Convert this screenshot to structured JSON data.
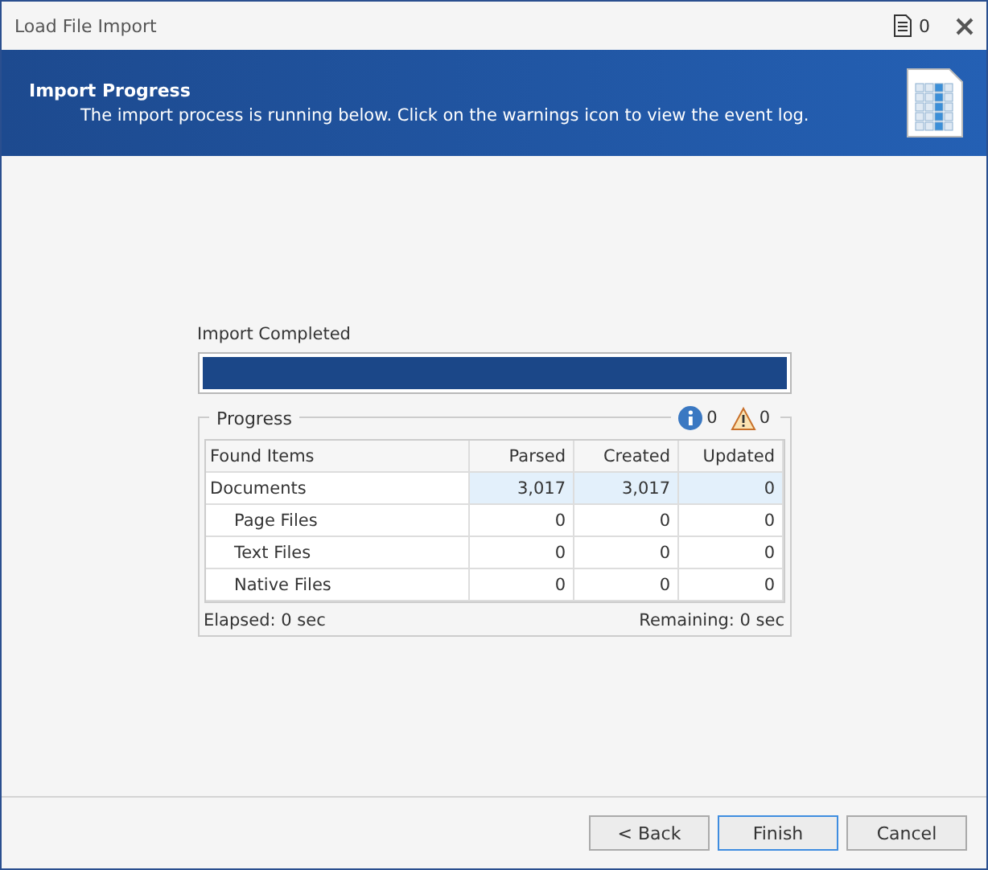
{
  "window": {
    "title": "Load File Import",
    "log_count": "0"
  },
  "header": {
    "title": "Import Progress",
    "subtitle": "The import process is running below. Click on the warnings icon to view the event log."
  },
  "status": {
    "label": "Import Completed",
    "level": 1
  },
  "progress": {
    "title": "Progress",
    "info_count": "0",
    "warning_count": "0",
    "columns": [
      "Found Items",
      "Parsed",
      "Created",
      "Updated"
    ],
    "rows": [
      {
        "name": "Documents",
        "parsed": "3,017",
        "created": "3,017",
        "updated": "0",
        "selected": true,
        "children": [
          {
            "name": "Page Files",
            "parsed": "0",
            "created": "0",
            "updated": "0",
            "selected": false
          },
          {
            "name": "Text Files",
            "parsed": "0",
            "created": "0",
            "updated": "0",
            "selected": false
          },
          {
            "name": "Native Files",
            "parsed": "0",
            "created": "0",
            "updated": "0",
            "selected": false
          }
        ]
      }
    ],
    "elapsed": "Elapsed: 0 sec",
    "remaining": "Remaining: 0 sec"
  },
  "buttons": [
    {
      "label": "< Back",
      "focused": false
    },
    {
      "label": "Finish",
      "focused": true
    },
    {
      "label": "Cancel",
      "focused": false
    }
  ]
}
